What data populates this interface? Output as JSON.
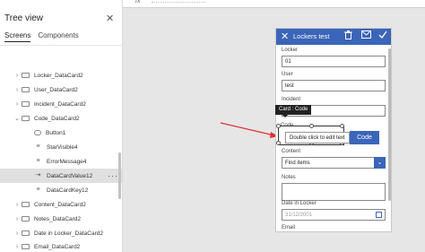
{
  "formula": {
    "fx": "fx"
  },
  "tree": {
    "title": "Tree view",
    "close": "✕",
    "tabs": [
      {
        "label": "Screens"
      },
      {
        "label": "Components"
      }
    ],
    "rows": [
      {
        "label": "Locker_DataCard2"
      },
      {
        "label": "User_DataCard2"
      },
      {
        "label": "Incident_DataCard2"
      },
      {
        "label": "Code_DataCard2"
      },
      {
        "label": "Button1"
      },
      {
        "label": "StarVisible4"
      },
      {
        "label": "ErrorMessage4"
      },
      {
        "label": "DataCardValue12"
      },
      {
        "label": "DataCardKey12"
      },
      {
        "label": "Content_DataCard2"
      },
      {
        "label": "Notes_DataCard2"
      },
      {
        "label": "Date in Locker_DataCard2"
      },
      {
        "label": "Email_DataCard2"
      }
    ],
    "more": "···"
  },
  "app": {
    "title": "Lockers test",
    "fields": {
      "locker_label": "Locker",
      "locker_value": "01",
      "user_label": "User",
      "user_value": "test",
      "incident_label": "Incident",
      "code_label": "Code",
      "content_label": "Content",
      "content_value": "Find items",
      "notes_label": "Notes",
      "date_label": "Date in Locker",
      "date_value": "31/12/2001",
      "email_label": "Email"
    },
    "code_button": "Code",
    "card_tooltip": "Card : Code",
    "edit_tooltip": "Double click to edit text"
  },
  "colors": {
    "accent": "#3b65b8",
    "arrow": "#e03030"
  }
}
